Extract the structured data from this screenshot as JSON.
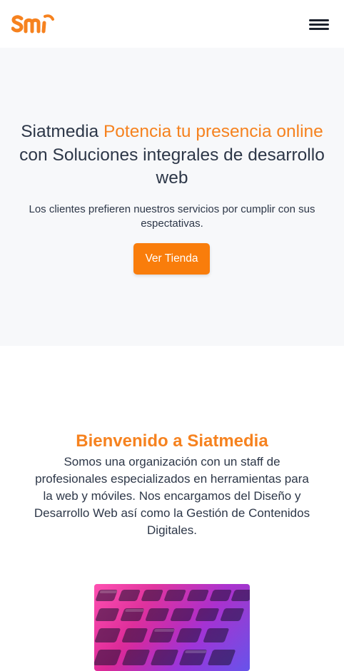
{
  "header": {
    "logo_text": "smi",
    "menu_icon": "hamburger-icon"
  },
  "hero": {
    "title_brand": "Siatmedia",
    "title_accent": "Potencia tu presencia online",
    "title_rest": "con Soluciones integrales de desarrollo web",
    "subtitle": "Los clientes prefieren nuestros servicios por cumplir con sus espectativas.",
    "cta_label": "Ver Tienda"
  },
  "welcome": {
    "title": "Bienvenido a Siatmedia",
    "text": "Somos una organización con un staff de profesionales especializados en herramientas para la web y móviles. Nos encargamos del Diseño y Desarrollo Web así como la Gestión de Contenidos Digitales."
  },
  "promo_image": {
    "subject": "keyboard-photo"
  },
  "colors": {
    "accent": "#f6821f",
    "button": "#f97d0b",
    "text": "#2d3748",
    "hero_bg": "#f7f8fa"
  }
}
